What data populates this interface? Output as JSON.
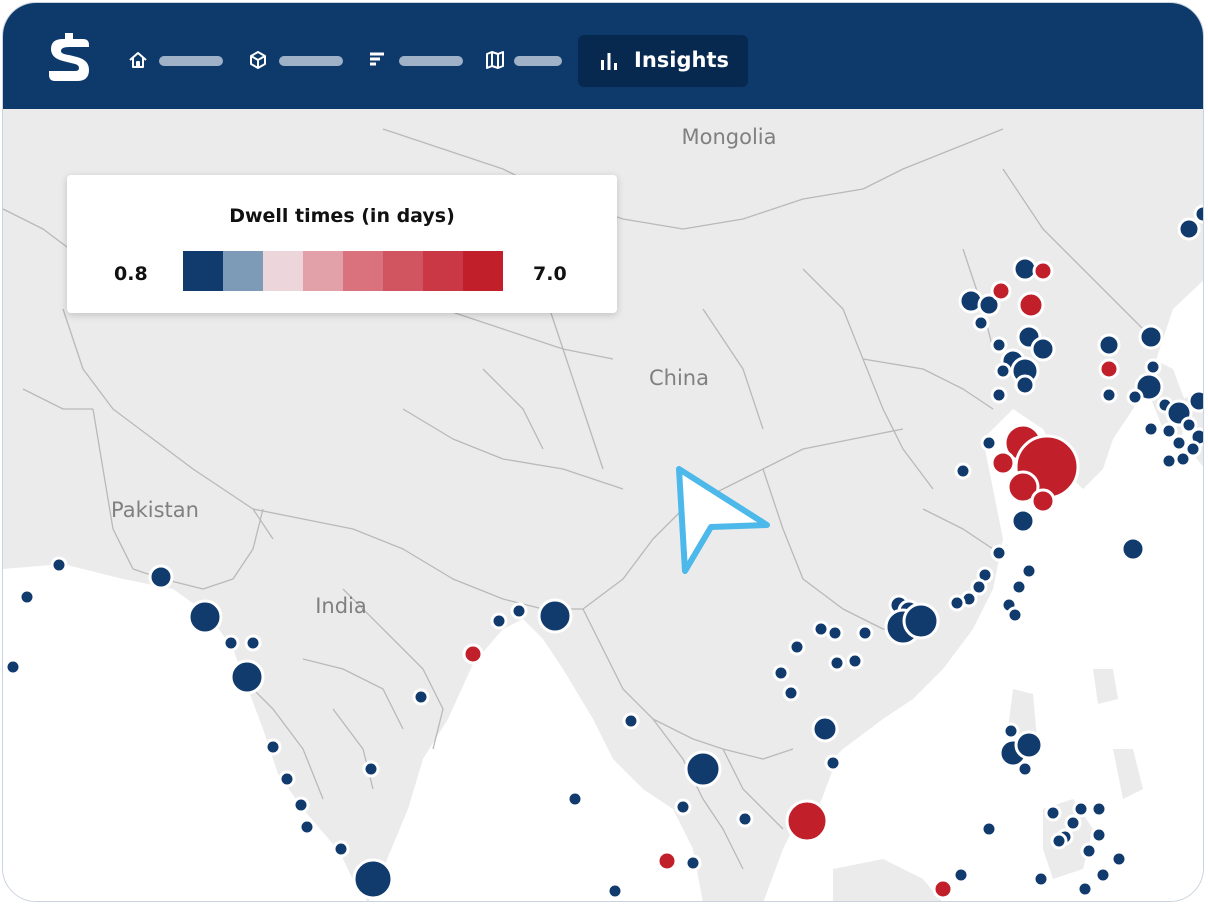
{
  "app": {
    "logo_icon": "stylized-s-logo",
    "nav": [
      {
        "icon": "home-icon"
      },
      {
        "icon": "cube-icon"
      },
      {
        "icon": "list-icon"
      },
      {
        "icon": "map-icon"
      }
    ],
    "active_tab": {
      "icon": "bar-chart-icon",
      "label": "Insights"
    }
  },
  "map": {
    "country_labels": [
      "Mongolia",
      "China",
      "Pakistan",
      "India"
    ],
    "legend": {
      "title": "Dwell times (in days)",
      "min_label": "0.8",
      "max_label": "7.0",
      "colors": [
        "#113a6d",
        "#7d9ab6",
        "#ecd6dc",
        "#e2a1a8",
        "#d9727c",
        "#d05560",
        "#c93844",
        "#c11f2a"
      ]
    }
  },
  "colors": {
    "header": "#0e3a6b",
    "active_tab": "#08294f",
    "low_dwell": "#113a6d",
    "high_dwell": "#c11f2a",
    "cursor": "#4db8ea"
  }
}
